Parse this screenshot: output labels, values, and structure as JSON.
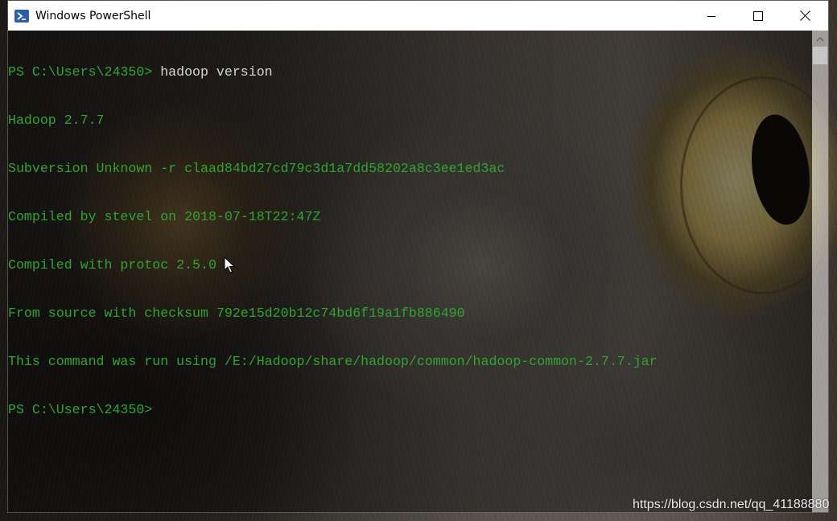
{
  "window": {
    "title": "Windows PowerShell",
    "icon": "powershell-icon",
    "controls": [
      "minimize-icon",
      "maximize-icon",
      "close-icon"
    ]
  },
  "console": {
    "prompt": "PS C:\\Users\\24350>",
    "command": " hadoop version",
    "output": [
      "Hadoop 2.7.7",
      "Subversion Unknown -r claad84bd27cd79c3d1a7dd58202a8c3ee1ed3ac",
      "Compiled by stevel on 2018-07-18T22:47Z",
      "Compiled with protoc 2.5.0",
      "From source with checksum 792e15d20b12c74bd6f19a1fb886490",
      "This command was run using /E:/Hadoop/share/hadoop/common/hadoop-common-2.7.7.jar"
    ],
    "final_prompt": "PS C:\\Users\\24350>"
  },
  "colors": {
    "console_text": "#2fa52f",
    "command_text": "#d6d6d6"
  },
  "watermark": "https://blog.csdn.net/qq_41188880"
}
